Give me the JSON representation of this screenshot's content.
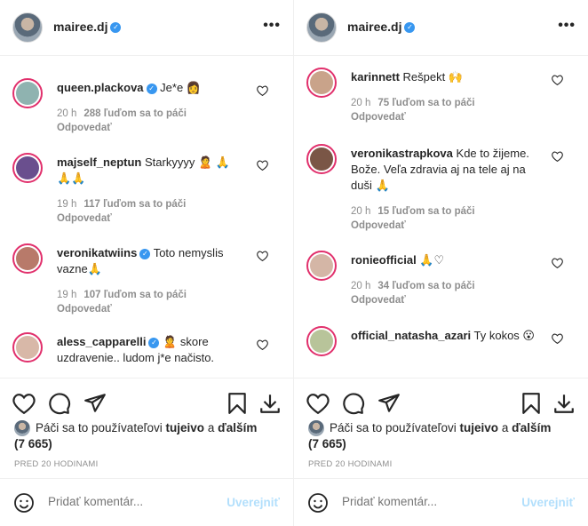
{
  "left": {
    "header": {
      "username": "mairee.dj",
      "more": "•••"
    },
    "comments": [
      {
        "user": "queen.plackova",
        "verified": true,
        "text": "Je*e 👩",
        "time": "20 h",
        "likes": "288 ľuďom sa to páči",
        "reply": "Odpovedať",
        "avatar_color": "#8fb3b0"
      },
      {
        "user": "majself_neptun",
        "verified": false,
        "text": "Starkyyyy 🙎 🙏🙏🙏",
        "time": "19 h",
        "likes": "117 ľuďom sa to páči",
        "reply": "Odpovedať",
        "avatar_color": "#6a4f8e"
      },
      {
        "user": "veronikatwiins",
        "verified": true,
        "text": "Toto nemyslis vazne🙏",
        "time": "19 h",
        "likes": "107 ľuďom sa to páči",
        "reply": "Odpovedať",
        "avatar_color": "#b87a6a"
      },
      {
        "user": "aless_capparelli",
        "verified": true,
        "text": "🙎 skore uzdravenie.. ludom j*e načisto.",
        "time": "",
        "likes": "",
        "reply": "",
        "avatar_color": "#d8b8a8"
      }
    ],
    "likes_prefix": "Páči sa to používateľovi",
    "likes_user": "tujeivo",
    "likes_and": "a",
    "likes_others": "ďalším (7 665)",
    "time_ago": "PRED 20 HODINAMI",
    "add_placeholder": "Pridať komentár...",
    "post_label": "Uverejniť"
  },
  "right": {
    "header": {
      "username": "mairee.dj",
      "more": "•••"
    },
    "comments": [
      {
        "user": "karinnett",
        "verified": false,
        "text": "Rešpekt 🙌",
        "time": "20 h",
        "likes": "75 ľuďom sa to páči",
        "reply": "Odpovedať",
        "avatar_color": "#c9a38a"
      },
      {
        "user": "veronikastrapkova",
        "verified": false,
        "text": "Kde to žijeme. Bože. Veľa zdravia aj na tele aj na duši 🙏",
        "time": "20 h",
        "likes": "15 ľuďom sa to páči",
        "reply": "Odpovedať",
        "avatar_color": "#7a5646"
      },
      {
        "user": "ronieofficial",
        "verified": false,
        "text": "🙏♡",
        "time": "20 h",
        "likes": "34 ľuďom sa to páči",
        "reply": "Odpovedať",
        "avatar_color": "#d4b6a6"
      },
      {
        "user": "official_natasha_azari",
        "verified": false,
        "text": "Ty kokos 😮",
        "time": "",
        "likes": "",
        "reply": "",
        "avatar_color": "#b8c49a"
      }
    ],
    "likes_prefix": "Páči sa to používateľovi",
    "likes_user": "tujeivo",
    "likes_and": "a",
    "likes_others": "ďalším (7 665)",
    "time_ago": "PRED 20 HODINAMI",
    "add_placeholder": "Pridať komentár...",
    "post_label": "Uverejniť"
  },
  "colors": {
    "verified": "#3897f0",
    "story_ring": "#e1306c",
    "post_disabled": "#b2dffc",
    "muted": "#8e8e8e"
  },
  "icons": [
    "heart-icon",
    "comment-icon",
    "share-icon",
    "bookmark-icon",
    "download-icon",
    "emoji-icon",
    "verified-icon",
    "more-icon"
  ]
}
